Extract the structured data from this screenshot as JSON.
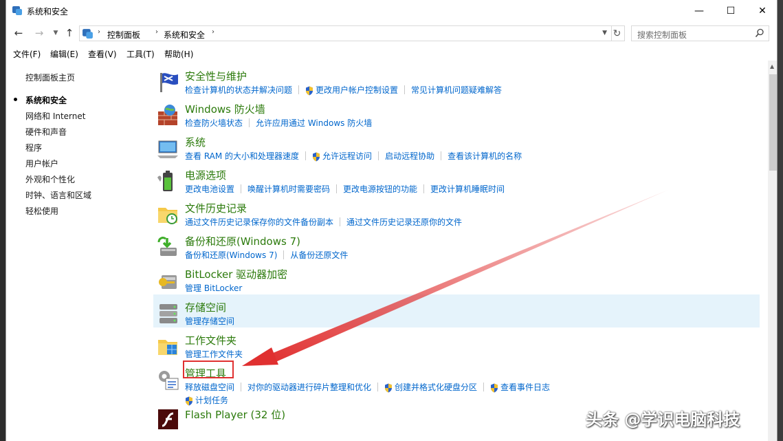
{
  "window": {
    "title": "系统和安全"
  },
  "window_controls": {
    "minimize": "—",
    "maximize": "☐",
    "close": "✕"
  },
  "address": {
    "crumbs": [
      "控制面板",
      "系统和安全"
    ]
  },
  "search": {
    "placeholder": "搜索控制面板"
  },
  "menu": [
    "文件(F)",
    "编辑(E)",
    "查看(V)",
    "工具(T)",
    "帮助(H)"
  ],
  "sidebar": {
    "home": "控制面板主页",
    "items": [
      "系统和安全",
      "网络和 Internet",
      "硬件和声音",
      "程序",
      "用户帐户",
      "外观和个性化",
      "时钟、语言和区域",
      "轻松使用"
    ],
    "current_index": 0
  },
  "categories": [
    {
      "title": "安全性与维护",
      "icon": "security-flag-icon",
      "links": [
        {
          "text": "检查计算机的状态并解决问题",
          "shield": false
        },
        {
          "text": "更改用户帐户控制设置",
          "shield": true
        },
        {
          "text": "常见计算机问题疑难解答",
          "shield": false
        }
      ]
    },
    {
      "title": "Windows 防火墙",
      "icon": "firewall-icon",
      "links": [
        {
          "text": "检查防火墙状态",
          "shield": false
        },
        {
          "text": "允许应用通过 Windows 防火墙",
          "shield": false
        }
      ]
    },
    {
      "title": "系统",
      "icon": "system-computer-icon",
      "links": [
        {
          "text": "查看 RAM 的大小和处理器速度",
          "shield": false
        },
        {
          "text": "允许远程访问",
          "shield": true
        },
        {
          "text": "启动远程协助",
          "shield": false
        },
        {
          "text": "查看该计算机的名称",
          "shield": false
        }
      ]
    },
    {
      "title": "电源选项",
      "icon": "power-battery-icon",
      "links": [
        {
          "text": "更改电池设置",
          "shield": false
        },
        {
          "text": "唤醒计算机时需要密码",
          "shield": false
        },
        {
          "text": "更改电源按钮的功能",
          "shield": false
        },
        {
          "text": "更改计算机睡眠时间",
          "shield": false
        }
      ]
    },
    {
      "title": "文件历史记录",
      "icon": "file-history-icon",
      "links": [
        {
          "text": "通过文件历史记录保存你的文件备份副本",
          "shield": false
        },
        {
          "text": "通过文件历史记录还原你的文件",
          "shield": false
        }
      ]
    },
    {
      "title": "备份和还原(Windows 7)",
      "icon": "backup-restore-icon",
      "links": [
        {
          "text": "备份和还原(Windows 7)",
          "shield": false
        },
        {
          "text": "从备份还原文件",
          "shield": false
        }
      ]
    },
    {
      "title": "BitLocker 驱动器加密",
      "icon": "bitlocker-key-icon",
      "links": [
        {
          "text": "管理 BitLocker",
          "shield": false
        }
      ]
    },
    {
      "title": "存储空间",
      "icon": "storage-spaces-icon",
      "links": [
        {
          "text": "管理存储空间",
          "shield": false
        }
      ]
    },
    {
      "title": "工作文件夹",
      "icon": "work-folders-icon",
      "links": [
        {
          "text": "管理工作文件夹",
          "shield": false
        }
      ]
    },
    {
      "title": "管理工具",
      "icon": "admin-tools-icon",
      "links": [
        {
          "text": "释放磁盘空间",
          "shield": false
        },
        {
          "text": "对你的驱动器进行碎片整理和优化",
          "shield": false
        },
        {
          "text": "创建并格式化硬盘分区",
          "shield": true
        },
        {
          "text": "查看事件日志",
          "shield": true
        }
      ],
      "links2": [
        {
          "text": "计划任务",
          "shield": true
        }
      ]
    },
    {
      "title": "Flash Player (32 位)",
      "icon": "flash-player-icon",
      "links": []
    }
  ],
  "highlighted_index": 7,
  "annotation": {
    "box_color": "#e03030",
    "arrow_color": "#e03030"
  },
  "watermark": "头条 @学识电脑科技",
  "colors": {
    "title_green": "#2b7a0b",
    "link_blue": "#0066cc",
    "hover_bg": "#e5f3fb"
  }
}
